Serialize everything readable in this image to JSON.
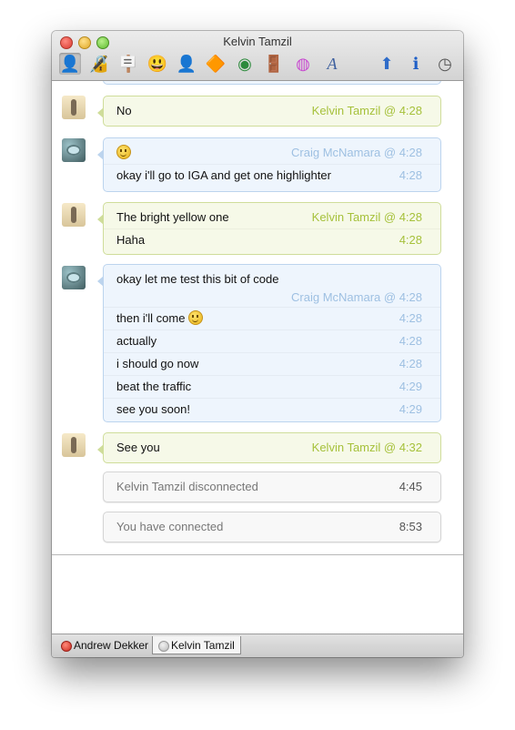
{
  "window": {
    "title": "Kelvin Tamzil"
  },
  "toolbar": [
    {
      "name": "user-info-icon",
      "glyph": "👤"
    },
    {
      "name": "lock-icon",
      "glyph": "🔏"
    },
    {
      "name": "signpost-icon",
      "glyph": "🪧"
    },
    {
      "name": "smiley-icon",
      "glyph": "😃"
    },
    {
      "name": "block-user-icon",
      "glyph": "👤"
    },
    {
      "name": "direction-sign-icon",
      "glyph": "🔶"
    },
    {
      "name": "chrome-icon",
      "glyph": "◉"
    },
    {
      "name": "door-icon",
      "glyph": "🚪"
    },
    {
      "name": "color-wheel-icon",
      "glyph": "◍"
    },
    {
      "name": "font-icon",
      "glyph": "A"
    },
    {
      "name": "send-file-icon",
      "glyph": "⬆"
    },
    {
      "name": "info-icon",
      "glyph": "ℹ"
    },
    {
      "name": "clock-icon",
      "glyph": "◷"
    }
  ],
  "messages": {
    "m1": {
      "text": "No",
      "time": "Kelvin Tamzil @ 4:28"
    },
    "m2": {
      "header": "Craig McNamara @ 4:28",
      "text": "okay i'll go to IGA and get one highlighter",
      "time": "4:28"
    },
    "m3": {
      "text1": "The bright yellow one",
      "time1": "Kelvin Tamzil @ 4:28",
      "text2": "Haha",
      "time2": "4:28"
    },
    "m4": {
      "text1": "okay let me test this bit of code",
      "header": "Craig McNamara @ 4:28",
      "text2": "then i'll come",
      "time2": "4:28",
      "text3": "actually",
      "time3": "4:28",
      "text4": "i should go now",
      "time4": "4:28",
      "text5": "beat the traffic",
      "time5": "4:29",
      "text6": "see you soon!",
      "time6": "4:29"
    },
    "m5": {
      "text": "See you",
      "time": "Kelvin Tamzil @ 4:32"
    },
    "s1": {
      "text": "Kelvin Tamzil disconnected",
      "time": "4:45"
    },
    "s2": {
      "text": "You have connected",
      "time": "8:53"
    }
  },
  "tabs": [
    {
      "label": "Andrew Dekker"
    },
    {
      "label": "Kelvin Tamzil"
    }
  ]
}
